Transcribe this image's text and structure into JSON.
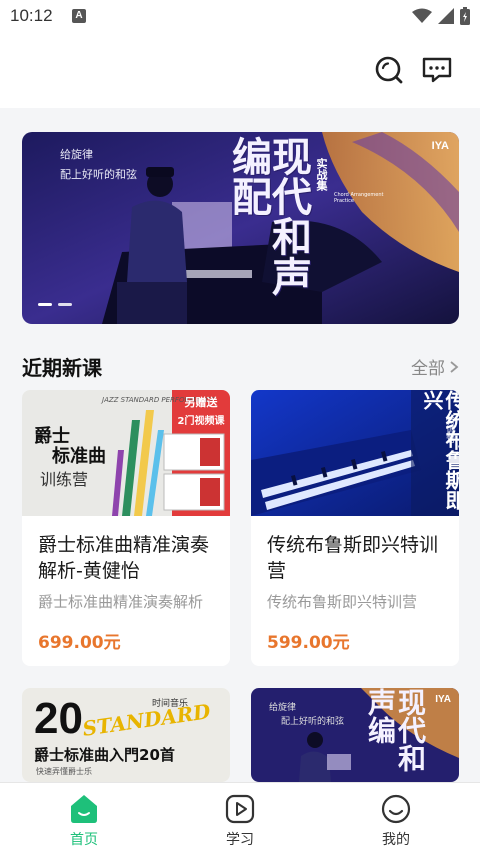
{
  "status_bar": {
    "time": "10:12",
    "indicator": "A"
  },
  "header": {
    "icons": [
      "search-icon",
      "message-icon"
    ]
  },
  "banner": {
    "subtitle_line1": "给旋律",
    "subtitle_line2": "配上好听的和弦",
    "title": "现代和声编配",
    "tag": "实战集",
    "brand": "IYA",
    "small_text": "Chord Arrangement Practice",
    "dots": 2
  },
  "section": {
    "title": "近期新课",
    "more": "全部"
  },
  "courses": [
    {
      "title": "爵士标准曲精准演奏解析-黄健怡",
      "subtitle": "爵士标准曲精准演奏解析",
      "price": "699.00元",
      "image": {
        "title_line1": "爵士",
        "title_line2": "标准曲",
        "title_line3": "训练营",
        "badge_line1": "另赠送",
        "badge_line2": "2门视频课",
        "caption": "JAZZ STANDARD PERFORMANCE"
      }
    },
    {
      "title": "传统布鲁斯即兴特训营",
      "subtitle": "传统布鲁斯即兴特训营",
      "price": "599.00元",
      "image": {
        "vertical_title": "传统布鲁斯即兴",
        "tag": "特训营"
      }
    },
    {
      "title": "",
      "subtitle": "",
      "price": "",
      "image": {
        "big": "20",
        "script": "STANDARD",
        "line": "爵士标准曲入門20首",
        "small": "快速弄懂爵士乐",
        "corner": "时间音乐"
      }
    },
    {
      "title": "",
      "subtitle": "",
      "price": "",
      "image": {
        "title": "现代和声编",
        "line1": "给旋律",
        "line2": "配上好听的和弦",
        "brand": "IYA"
      }
    }
  ],
  "tabbar": {
    "tabs": [
      {
        "label": "首页",
        "icon": "home-icon",
        "active": true
      },
      {
        "label": "学习",
        "icon": "play-icon",
        "active": false
      },
      {
        "label": "我的",
        "icon": "smile-icon",
        "active": false
      }
    ]
  },
  "colors": {
    "accent": "#1ec07a",
    "price": "#e8762d",
    "background": "#f4f5f7"
  }
}
